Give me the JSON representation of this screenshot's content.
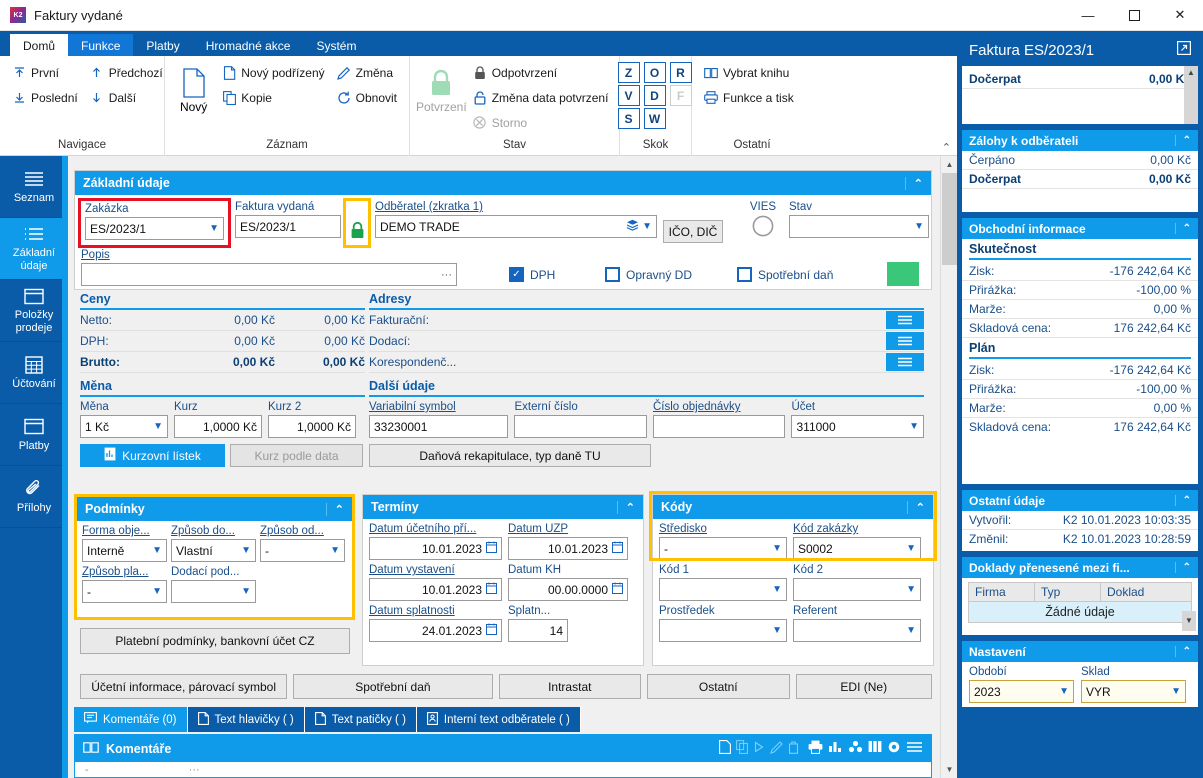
{
  "window": {
    "title": "Faktury vydané",
    "app_icon": "k2-logo-icon",
    "minimize": "—",
    "maximize": "☐",
    "close": "✕"
  },
  "ribbon": {
    "tabs": [
      {
        "label": "Domů",
        "state": "active"
      },
      {
        "label": "Funkce",
        "state": "hover"
      },
      {
        "label": "Platby",
        "state": "normal"
      },
      {
        "label": "Hromadné akce",
        "state": "normal"
      },
      {
        "label": "Systém",
        "state": "normal"
      }
    ],
    "groups": [
      {
        "label": "Navigace",
        "items": [
          {
            "label": "První",
            "icon": "arrow-up-top-icon"
          },
          {
            "label": "Poslední",
            "icon": "arrow-down-bottom-icon"
          },
          {
            "label": "Předchozí",
            "icon": "arrow-up-icon"
          },
          {
            "label": "Další",
            "icon": "arrow-down-icon"
          }
        ]
      },
      {
        "label": "Záznam",
        "big": {
          "label": "Nový",
          "icon": "document-icon"
        },
        "items": [
          {
            "label": "Nový podřízený",
            "icon": "document-plus-icon"
          },
          {
            "label": "Kopie",
            "icon": "copy-icon"
          },
          {
            "label": "Změna",
            "icon": "pencil-icon"
          },
          {
            "label": "Obnovit",
            "icon": "refresh-icon"
          }
        ]
      },
      {
        "label": "Stav",
        "big": {
          "label": "Potvrzení",
          "icon": "lock-green-icon",
          "disabled": true
        },
        "items": [
          {
            "label": "Odpotvrzení",
            "icon": "lock-closed-icon"
          },
          {
            "label": "Změna data potvrzení",
            "icon": "lock-open-icon"
          },
          {
            "label": "Storno",
            "icon": "cancel-circle-icon",
            "disabled": true
          }
        ]
      },
      {
        "label": "Skok",
        "keys": [
          {
            "label": "Z",
            "enabled": true
          },
          {
            "label": "O",
            "enabled": true
          },
          {
            "label": "R",
            "enabled": true
          },
          {
            "label": "V",
            "enabled": true
          },
          {
            "label": "D",
            "enabled": true
          },
          {
            "label": "F",
            "enabled": false
          },
          {
            "label": "S",
            "enabled": true
          },
          {
            "label": "W",
            "enabled": true
          }
        ]
      },
      {
        "label": "Ostatní",
        "items": [
          {
            "label": "Vybrat knihu",
            "icon": "book-icon"
          },
          {
            "label": "Funkce a tisk",
            "icon": "printer-icon"
          }
        ]
      }
    ],
    "collapse_icon": "chevron-up-icon"
  },
  "left_sidebar": {
    "items": [
      {
        "label": "Seznam",
        "icon": "list-icon",
        "active": false
      },
      {
        "label": "Základní údaje",
        "icon": "form-list-icon",
        "active": true
      },
      {
        "label": "Položky prodeje",
        "icon": "box-icon",
        "active": false
      },
      {
        "label": "Účtování",
        "icon": "calculator-icon",
        "active": false
      },
      {
        "label": "Platby",
        "icon": "box-icon",
        "active": false
      },
      {
        "label": "Přílohy",
        "icon": "paperclip-icon",
        "active": false
      }
    ]
  },
  "form": {
    "basic": {
      "title": "Základní údaje",
      "zakazka": {
        "label": "Zakázka",
        "value": "ES/2023/1",
        "highlight": "#e81123"
      },
      "faktura": {
        "label": "Faktura vydaná",
        "value": "ES/2023/1"
      },
      "lock": {
        "icon": "lock-green-icon",
        "highlight": "#ffc000"
      },
      "odberatel": {
        "label": "Odběratel (zkratka 1)",
        "value": "DEMO TRADE"
      },
      "ico_btn": "IČO, DIČ",
      "vies": {
        "label": "VIES",
        "icon": "circle-icon"
      },
      "stav": {
        "label": "Stav",
        "value": ""
      },
      "popis": {
        "label": "Popis",
        "value": "",
        "ellipsis": "···"
      },
      "checkboxes": [
        {
          "label": "DPH",
          "checked": true
        },
        {
          "label": "Opravný DD",
          "checked": false
        },
        {
          "label": "Spotřební daň",
          "checked": false
        }
      ],
      "status_swatch": "#3bc77a"
    },
    "ceny": {
      "title": "Ceny",
      "rows": [
        {
          "label": "Netto:",
          "v1": "0,00 Kč",
          "v2": "0,00 Kč",
          "bold": false
        },
        {
          "label": "DPH:",
          "v1": "0,00 Kč",
          "v2": "0,00 Kč",
          "bold": false
        },
        {
          "label": "Brutto:",
          "v1": "0,00 Kč",
          "v2": "0,00 Kč",
          "bold": true
        }
      ]
    },
    "adresy": {
      "title": "Adresy",
      "rows": [
        {
          "label": "Fakturační:",
          "value": "",
          "icon": "menu-lines-icon"
        },
        {
          "label": "Dodací:",
          "value": "",
          "icon": "menu-lines-icon"
        },
        {
          "label": "Korespondenč...",
          "value": "",
          "icon": "menu-lines-icon"
        }
      ]
    },
    "mena": {
      "title": "Měna",
      "fields": [
        {
          "label": "Měna",
          "value": "1 Kč",
          "dropdown": true,
          "align": "left"
        },
        {
          "label": "Kurz",
          "value": "1,0000 Kč",
          "dropdown": false,
          "align": "right"
        },
        {
          "label": "Kurz 2",
          "value": "1,0000 Kč",
          "dropdown": false,
          "align": "right"
        }
      ],
      "buttons": [
        {
          "label": "Kurzovní lístek",
          "style": "blue",
          "icon": "chart-doc-icon"
        },
        {
          "label": "Kurz podle data",
          "style": "disabled"
        }
      ]
    },
    "dalsi_udaje": {
      "title": "Další údaje",
      "fields": [
        {
          "label": "Variabilní symbol",
          "value": "33230001",
          "dropdown": false
        },
        {
          "label": "Externí číslo",
          "value": "",
          "dropdown": false
        },
        {
          "label": "Číslo objednávky",
          "value": "",
          "dropdown": false
        },
        {
          "label": "Účet",
          "value": "311000",
          "dropdown": true
        }
      ],
      "tax_button": "Daňová rekapitulace, typ daně TU"
    },
    "podminky": {
      "title": "Podmínky",
      "highlight": "#ffc000",
      "fields": [
        {
          "label": "Forma obje...",
          "value": "Interně"
        },
        {
          "label": "Způsob do...",
          "value": "Vlastní"
        },
        {
          "label": "Způsob od...",
          "value": "-"
        },
        {
          "label": "Způsob pla...",
          "value": "-"
        },
        {
          "label": "Dodací pod...",
          "value": ""
        }
      ],
      "button": "Platební podmínky, bankovní účet CZ"
    },
    "terminy": {
      "title": "Termíny",
      "fields": [
        {
          "label": "Datum účetního pří...",
          "value": "10.01.2023",
          "icon": "calendar-icon"
        },
        {
          "label": "Datum UZP",
          "value": "10.01.2023",
          "icon": "calendar-icon"
        },
        {
          "label": "Datum vystavení",
          "value": "10.01.2023",
          "icon": "calendar-icon"
        },
        {
          "label": "Datum KH",
          "value": "00.00.0000",
          "icon": "calendar-icon"
        },
        {
          "label": "Datum splatnosti",
          "value": "24.01.2023",
          "icon": "calendar-icon"
        },
        {
          "label": "Splatn...",
          "value": "14",
          "icon": ""
        }
      ]
    },
    "kody": {
      "title": "Kódy",
      "highlight": "#ffc000",
      "fields": [
        {
          "label": "Středisko",
          "value": "-"
        },
        {
          "label": "Kód zakázky",
          "value": "S0002"
        },
        {
          "label": "Kód 1",
          "value": ""
        },
        {
          "label": "Kód 2",
          "value": ""
        },
        {
          "label": "Prostředek",
          "value": ""
        },
        {
          "label": "Referent",
          "value": ""
        }
      ]
    },
    "bottom_buttons": [
      "Účetní informace, párovací symbol",
      "Spotřební daň",
      "Intrastat",
      "Ostatní",
      "EDI (Ne)"
    ],
    "tabs": [
      {
        "label": "Komentáře (0)",
        "icon": "comment-icon",
        "active": true
      },
      {
        "label": "Text hlavičky ( )",
        "icon": "document-icon",
        "active": false
      },
      {
        "label": "Text patičky ( )",
        "icon": "document-icon",
        "active": false
      },
      {
        "label": "Interní text odběratele ( )",
        "icon": "person-doc-icon",
        "active": false
      }
    ],
    "grid": {
      "title": "Komentáře",
      "title_icon": "book-icon",
      "toolbar": [
        {
          "icon": "new-doc-icon",
          "enabled": true
        },
        {
          "icon": "copy-icon",
          "enabled": false
        },
        {
          "icon": "play-icon",
          "enabled": false
        },
        {
          "icon": "pencil-icon",
          "enabled": false
        },
        {
          "icon": "trash-icon",
          "enabled": false
        },
        {
          "icon": "printer-icon",
          "enabled": true
        },
        {
          "icon": "bar-chart-icon",
          "enabled": true
        },
        {
          "icon": "cubes-icon",
          "enabled": true
        },
        {
          "icon": "columns-icon",
          "enabled": true
        },
        {
          "icon": "gear-icon",
          "enabled": true
        },
        {
          "icon": "menu-lines-icon",
          "enabled": true
        }
      ]
    }
  },
  "right_sidebar": {
    "title": "Faktura ES/2023/1",
    "popout_icon": "popout-icon",
    "top_panel": {
      "rows": [
        {
          "label": "Dočerpat",
          "value": "0,00 Kč",
          "bold": true
        }
      ]
    },
    "zalohy": {
      "title": "Zálohy k odběrateli",
      "rows": [
        {
          "label": "Čerpáno",
          "value": "0,00 Kč",
          "bold": false
        },
        {
          "label": "Dočerpat",
          "value": "0,00 Kč",
          "bold": true
        }
      ]
    },
    "obchodni": {
      "title": "Obchodní informace",
      "groups": [
        {
          "name": "Skutečnost",
          "rows": [
            {
              "label": "Zisk:",
              "value": "-176 242,64 Kč"
            },
            {
              "label": "Přirážka:",
              "value": "-100,00 %"
            },
            {
              "label": "Marže:",
              "value": "0,00 %"
            },
            {
              "label": "Skladová cena:",
              "value": "176 242,64 Kč"
            }
          ]
        },
        {
          "name": "Plán",
          "rows": [
            {
              "label": "Zisk:",
              "value": "-176 242,64 Kč"
            },
            {
              "label": "Přirážka:",
              "value": "-100,00 %"
            },
            {
              "label": "Marže:",
              "value": "0,00 %"
            },
            {
              "label": "Skladová cena:",
              "value": "176 242,64 Kč"
            }
          ]
        }
      ]
    },
    "ostatni": {
      "title": "Ostatní údaje",
      "rows": [
        {
          "label": "Vytvořil:",
          "value": "K2 10.01.2023 10:03:35"
        },
        {
          "label": "Změnil:",
          "value": "K2 10.01.2023 10:28:59"
        }
      ]
    },
    "doklady": {
      "title": "Doklady přenesené mezi fi...",
      "columns": [
        "Firma",
        "Typ",
        "Doklad"
      ],
      "empty_text": "Žádné údaje"
    },
    "nastaveni": {
      "title": "Nastavení",
      "fields": [
        {
          "label": "Období",
          "value": "2023"
        },
        {
          "label": "Sklad",
          "value": "VYR"
        }
      ]
    }
  }
}
